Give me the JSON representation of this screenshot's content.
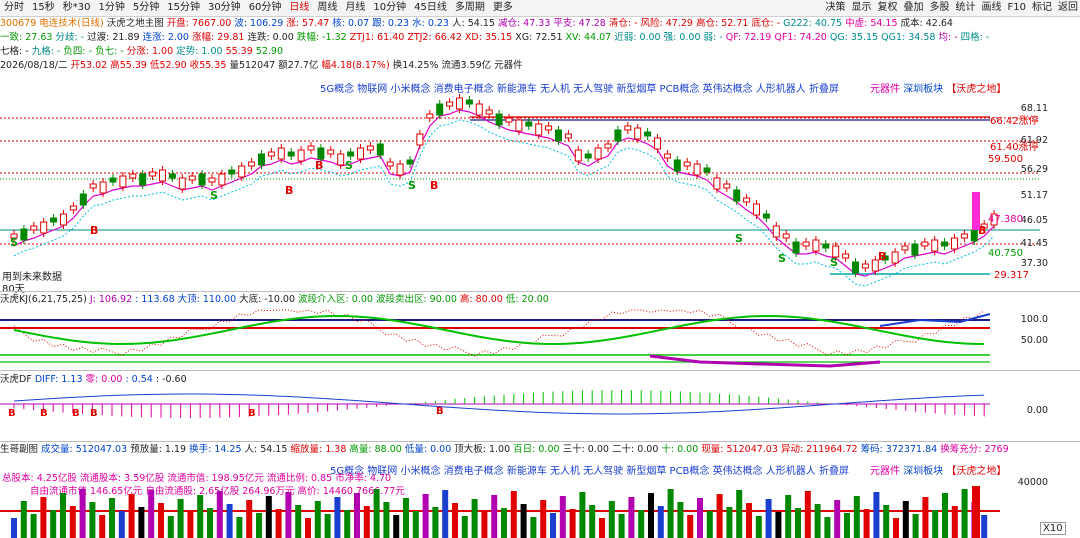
{
  "toolbar": {
    "tabs": [
      "分时",
      "15秒",
      "秒*30",
      "1分钟",
      "5分钟",
      "15分钟",
      "30分钟",
      "60分钟",
      "日线",
      "周线",
      "月线",
      "10分钟",
      "45日线",
      "多周期",
      "更多"
    ],
    "active_tab": "日线",
    "right_tools": [
      "决策",
      "显示",
      "复权",
      "叠加",
      "多股",
      "统计",
      "画线",
      "F10",
      "标记",
      "返回"
    ]
  },
  "header": {
    "code_name": "300679 电连技术(日线)",
    "indicator_name": "沃虎之地主图",
    "open": "开盘: 7667.00",
    "bo": "波: 106.29",
    "zhang": "涨: 57.47",
    "he": "核: 0.07",
    "gen": "跟: 0.23",
    "shui": "水: 0.23",
    "ren": "人: 54.15",
    "jiancang": "减仓: 47.33",
    "pingzhi": "平支: 47.28",
    "qingcang": "清仓: -",
    "fengxian": "风险: 47.29",
    "gaoge": "高仓: 52.71",
    "dicang": "底仓: -",
    "g222": "G222: 40.75",
    "zhongxian": "中虚: 54.15",
    "chengben": "成本: 42.64"
  },
  "line2": {
    "yizhi": "一致: 27.63",
    "fenqi": "分歧: -",
    "guoyu": "过渡: 21.89",
    "lianzhang": "连涨: 2.00",
    "zhangfu": "涨幅: 29.81",
    "liandie": "连跌: 0.00",
    "dieFu": "跌幅: -1.32",
    "ztj1": "ZTJ1: 61.40",
    "ztj2": "ZTJ2: 66.42",
    "xd": "XD: 35.15",
    "xg": "XG: 72.51",
    "xv": "XV: 44.07",
    "jinqi": "近弱: 0.00",
    "qiang": "强: 0.00",
    "ruo": "弱: -",
    "qf": "QF: 72.19",
    "qf1": "QF1: 74.20",
    "qg": "QG: 35.15",
    "qg1": "QG1: 34.58",
    "jun": "均: -",
    "sige": "四格: -"
  },
  "line3": {
    "qige": "七格: -",
    "jiuge": "九格: -",
    "fusi": "负四: -",
    "fuqi": "负七: -",
    "fenzhang": "分涨: 1.00",
    "dingshi": "定势: 1.00",
    "v1": "55.39",
    "v2": "52.90"
  },
  "line4": {
    "date": "2026/08/18/二",
    "open": "开53.02",
    "high": "高55.39",
    "low": "低52.90",
    "close": "收55.35",
    "vol": "量512047",
    "amount": "额27.7亿",
    "range": "幅4.18(8.17%)",
    "turnover": "换14.25%",
    "float": "流通3.59亿",
    "sector": "元器件"
  },
  "concepts": "5G概念 物联网 小米概念 消费电子概念 新能源车 无人机 无人驾驶 新型烟草 PCB概念 英伟达概念 人形机器人 折叠屏",
  "concepts_tail": [
    "元器件",
    "深圳板块",
    "【沃虎之地】"
  ],
  "main_axis": [
    "68.11",
    "61.92",
    "56.29",
    "51.17",
    "46.05",
    "41.45",
    "37.30"
  ],
  "price_labels": {
    "zt2": "66.42涨停",
    "zt1": "61.40涨停",
    "p59": "59.500",
    "p47": "47.380",
    "p40": "40.750",
    "p29": "29.317"
  },
  "future_note": "用到未来数据",
  "days80": "80天",
  "kdj": {
    "title": "沃虎KJ(6,21,75,25)",
    "j": "J: 106.92",
    "v2": ": 113.68",
    "dading": "大顶: 110.00",
    "dadi": "大底: -10.00",
    "boduan_in": "波段介入区: 0.00",
    "boduan_out": "波段卖出区: 90.00",
    "gao": "高: 80.00",
    "di": "低: 20.00",
    "axis": [
      "100.0",
      "50.00"
    ]
  },
  "df": {
    "title": "沃虎DF",
    "diff": "DIFF: 1.13",
    "zero": "零: 0.00",
    "v1": ": 0.54",
    "v2": ": -0.60",
    "axis": [
      "0.00"
    ]
  },
  "vol": {
    "title": "生哥副图",
    "items": [
      "成交量: 512047.03",
      "预放量: 1.19",
      "换手: 14.25",
      "人: 54.15",
      "缩放量: 1.38",
      "高量: 88.00",
      "低量: 0.00",
      "顶大板: 1.00",
      "百日: 0.00",
      "三十: 0.00",
      "二十: 0.00",
      "十: 0.00",
      "现量: 512047.03",
      "异动: 211964.72",
      "筹码: 372371.84",
      "换筹充分: 2769"
    ],
    "line2": [
      "总股本: 4.25亿股",
      "流通股本: 3.59亿股",
      "流通市值: 198.95亿元",
      "流通比例: 0.85",
      "市净率: 4.70"
    ],
    "line3": [
      "自由流通市值",
      "146.65亿元",
      "自由流通股: 2.65亿股",
      "264.96万元",
      "高价: 14460",
      "7666.77元"
    ],
    "axis": [
      "40000"
    ],
    "corner": "X10"
  },
  "colors": {
    "up": "#e00000",
    "down": "#008800",
    "bg": "#ffffff",
    "ma_pink": "#e000d0",
    "ma_cyan": "#00c0e0"
  }
}
